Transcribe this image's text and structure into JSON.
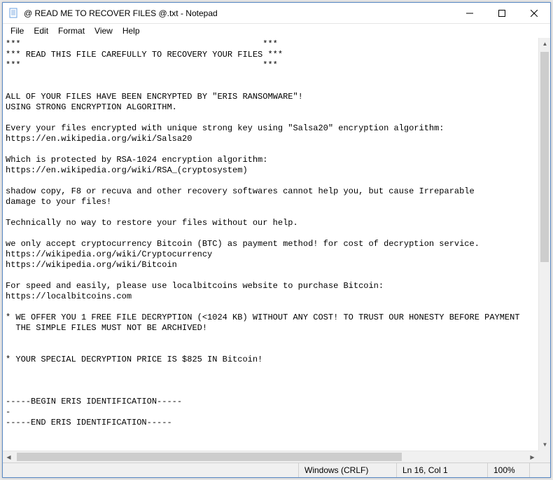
{
  "titlebar": {
    "title": "@ READ ME TO RECOVER FILES @.txt - Notepad"
  },
  "menubar": {
    "file": "File",
    "edit": "Edit",
    "format": "Format",
    "view": "View",
    "help": "Help"
  },
  "content": "***                                                ***\n*** READ THIS FILE CAREFULLY TO RECOVERY YOUR FILES ***\n***                                                ***\n\n\nALL OF YOUR FILES HAVE BEEN ENCRYPTED BY \"ERIS RANSOMWARE\"!\nUSING STRONG ENCRYPTION ALGORITHM.\n\nEvery your files encrypted with unique strong key using \"Salsa20\" encryption algorithm:\nhttps://en.wikipedia.org/wiki/Salsa20\n\nWhich is protected by RSA-1024 encryption algorithm:\nhttps://en.wikipedia.org/wiki/RSA_(cryptosystem)\n\nshadow copy, F8 or recuva and other recovery softwares cannot help you, but cause Irreparable\ndamage to your files!\n\nTechnically no way to restore your files without our help.\n\nwe only accept cryptocurrency Bitcoin (BTC) as payment method! for cost of decryption service.\nhttps://wikipedia.org/wiki/Cryptocurrency\nhttps://wikipedia.org/wiki/Bitcoin\n\nFor speed and easily, please use localbitcoins website to purchase Bitcoin:\nhttps://localbitcoins.com\n\n* WE OFFER YOU 1 FREE FILE DECRYPTION (<1024 KB) WITHOUT ANY COST! TO TRUST OUR HONESTY BEFORE PAYMENT\n  THE SIMPLE FILES MUST NOT BE ARCHIVED!\n\n\n* YOUR SPECIAL DECRYPTION PRICE IS $825 IN Bitcoin!\n\n\n\n-----BEGIN ERIS IDENTIFICATION-----\n-\n-----END ERIS IDENTIFICATION-----",
  "statusbar": {
    "encoding": "Windows (CRLF)",
    "position": "Ln 16, Col 1",
    "zoom": "100%"
  }
}
